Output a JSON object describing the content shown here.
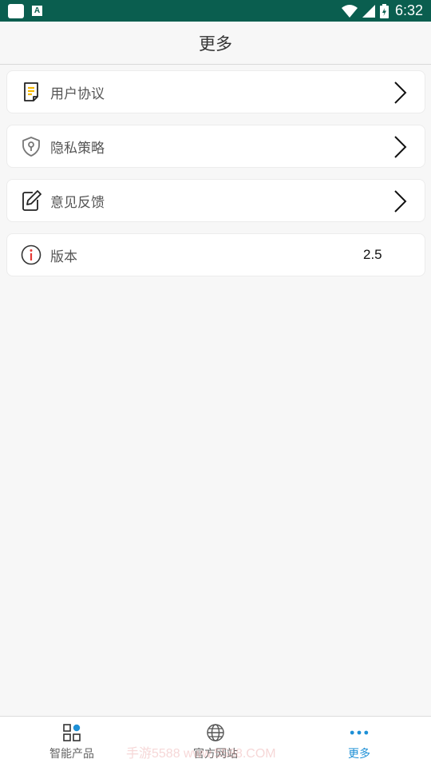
{
  "status_bar": {
    "time": "6:32",
    "a_glyph": "A"
  },
  "header": {
    "title": "更多"
  },
  "menu": [
    {
      "label": "用户协议",
      "icon": "document-icon",
      "chevron": true
    },
    {
      "label": "隐私策略",
      "icon": "shield-lock-icon",
      "chevron": true
    },
    {
      "label": "意见反馈",
      "icon": "edit-icon",
      "chevron": true
    },
    {
      "label": "版本",
      "icon": "info-icon",
      "value": "2.5"
    }
  ],
  "bottom_nav": [
    {
      "label": "智能产品",
      "icon": "grid-icon",
      "active": false
    },
    {
      "label": "官方网站",
      "icon": "globe-icon",
      "active": false
    },
    {
      "label": "更多",
      "icon": "more-dots-icon",
      "active": true
    }
  ],
  "watermark": "手游5588 www.5588.COM",
  "colors": {
    "status_bar": "#0a5e4f",
    "accent": "#1e90d6",
    "doc_accent": "#f5b800",
    "info_red": "#e53935"
  }
}
